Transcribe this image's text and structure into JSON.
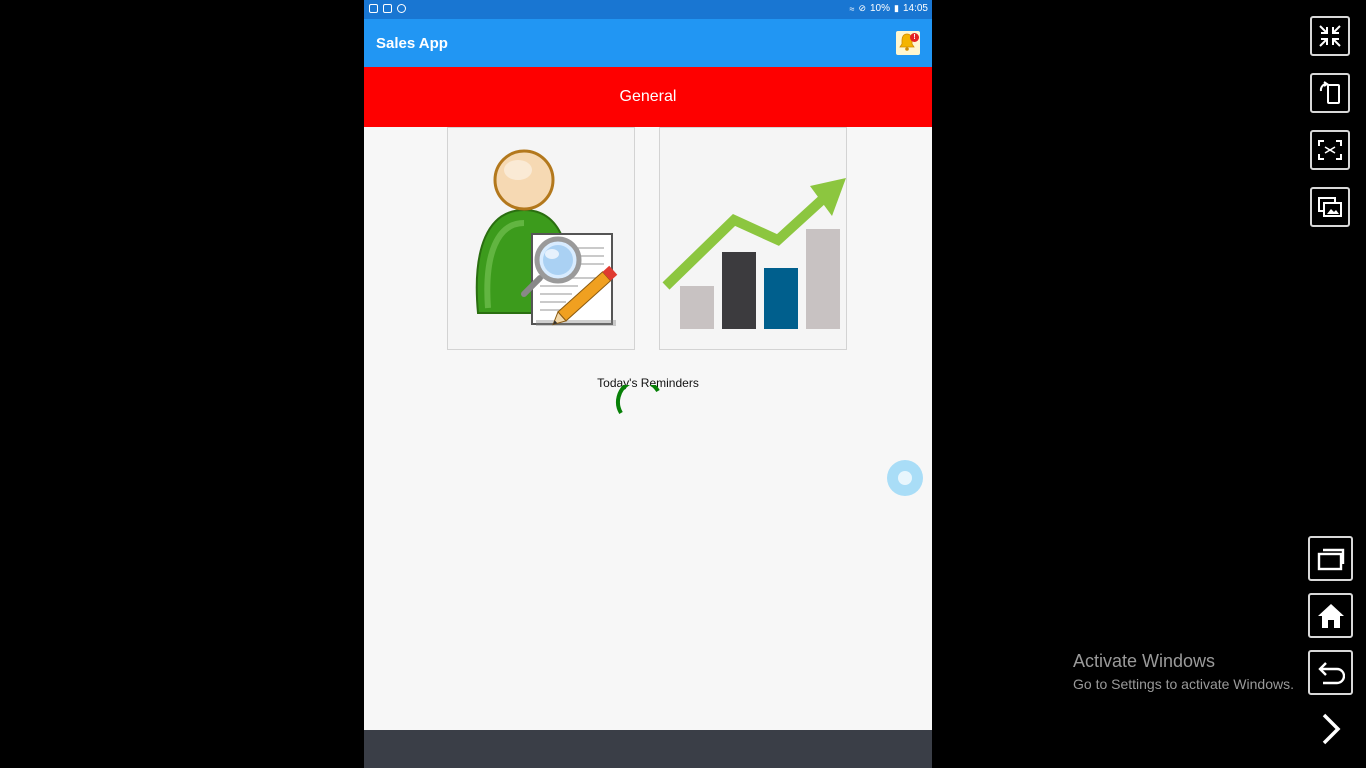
{
  "status_bar": {
    "battery": "10%",
    "time": "14:05"
  },
  "app_bar": {
    "title": "Sales App",
    "notification_badge": "!"
  },
  "banner": {
    "label": "General"
  },
  "tiles": [
    {
      "name": "customer-tile",
      "icon": "user-document-search-icon"
    },
    {
      "name": "sales-chart-tile",
      "icon": "growth-bar-chart-icon"
    }
  ],
  "reminders": {
    "heading": "Today's Reminders",
    "loading": true
  },
  "colors": {
    "status_bar": "#1976d2",
    "app_bar": "#2196f3",
    "banner": "#fe0000",
    "spinner": "#078007",
    "nav_bar": "#3a3e47"
  },
  "emulator_controls": [
    {
      "name": "exit-fullscreen-button",
      "icon": "collapse-arrows-icon"
    },
    {
      "name": "rotate-button",
      "icon": "rotate-device-icon"
    },
    {
      "name": "screenshot-button",
      "icon": "capture-screen-icon"
    },
    {
      "name": "gallery-button",
      "icon": "image-gallery-icon"
    },
    {
      "name": "recent-apps-button",
      "icon": "recent-apps-icon"
    },
    {
      "name": "home-button",
      "icon": "home-icon"
    },
    {
      "name": "back-button",
      "icon": "back-arrow-icon"
    },
    {
      "name": "expand-panel-button",
      "icon": "chevron-right-icon"
    }
  ],
  "watermark": {
    "title": "Activate Windows",
    "subtitle": "Go to Settings to activate Windows."
  }
}
